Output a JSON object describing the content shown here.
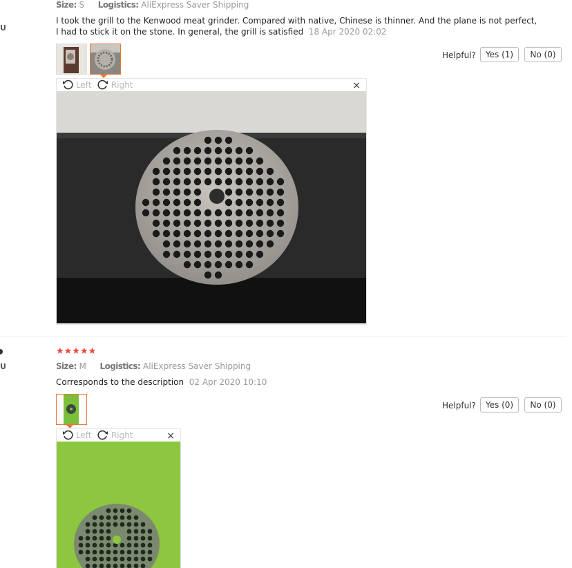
{
  "review1": {
    "size_label": "Size:",
    "size_value": "S",
    "logistics_label": "Logistics:",
    "logistics_value": "AliExpress Saver Shipping",
    "text_line1": "I took the grill to the Kenwood meat grinder. Compared with native, Chinese is thinner. And the plane is not perfect,",
    "text_line2": "I had to stick it on the stone. In general, the grill is satisfied",
    "date": "18 Apr 2020 02:02",
    "helpful_label": "Helpful?",
    "yes_label": "Yes (1)",
    "no_label": "No (0)",
    "viewer": {
      "left_label": "Left",
      "right_label": "Right",
      "close": "×"
    }
  },
  "review2": {
    "stars": "★★★★★",
    "rating": 5,
    "size_label": "Size:",
    "size_value": "M",
    "logistics_label": "Logistics:",
    "logistics_value": "AliExpress Saver Shipping",
    "text": "Corresponds to the description",
    "date": "02 Apr 2020 10:10",
    "helpful_label": "Helpful?",
    "yes_label": "Yes (0)",
    "no_label": "No (0)",
    "viewer": {
      "left_label": "Left",
      "right_label": "Right",
      "close": "×"
    }
  },
  "left_edge": {
    "u1": "U",
    "u2": "U"
  },
  "colors": {
    "accent": "#e8773a",
    "star": "#e8473a",
    "photo_green": "#8dc63f"
  },
  "icons": {
    "rotate_left": "rotate-left-icon",
    "rotate_right": "rotate-right-icon",
    "close": "close-icon"
  }
}
